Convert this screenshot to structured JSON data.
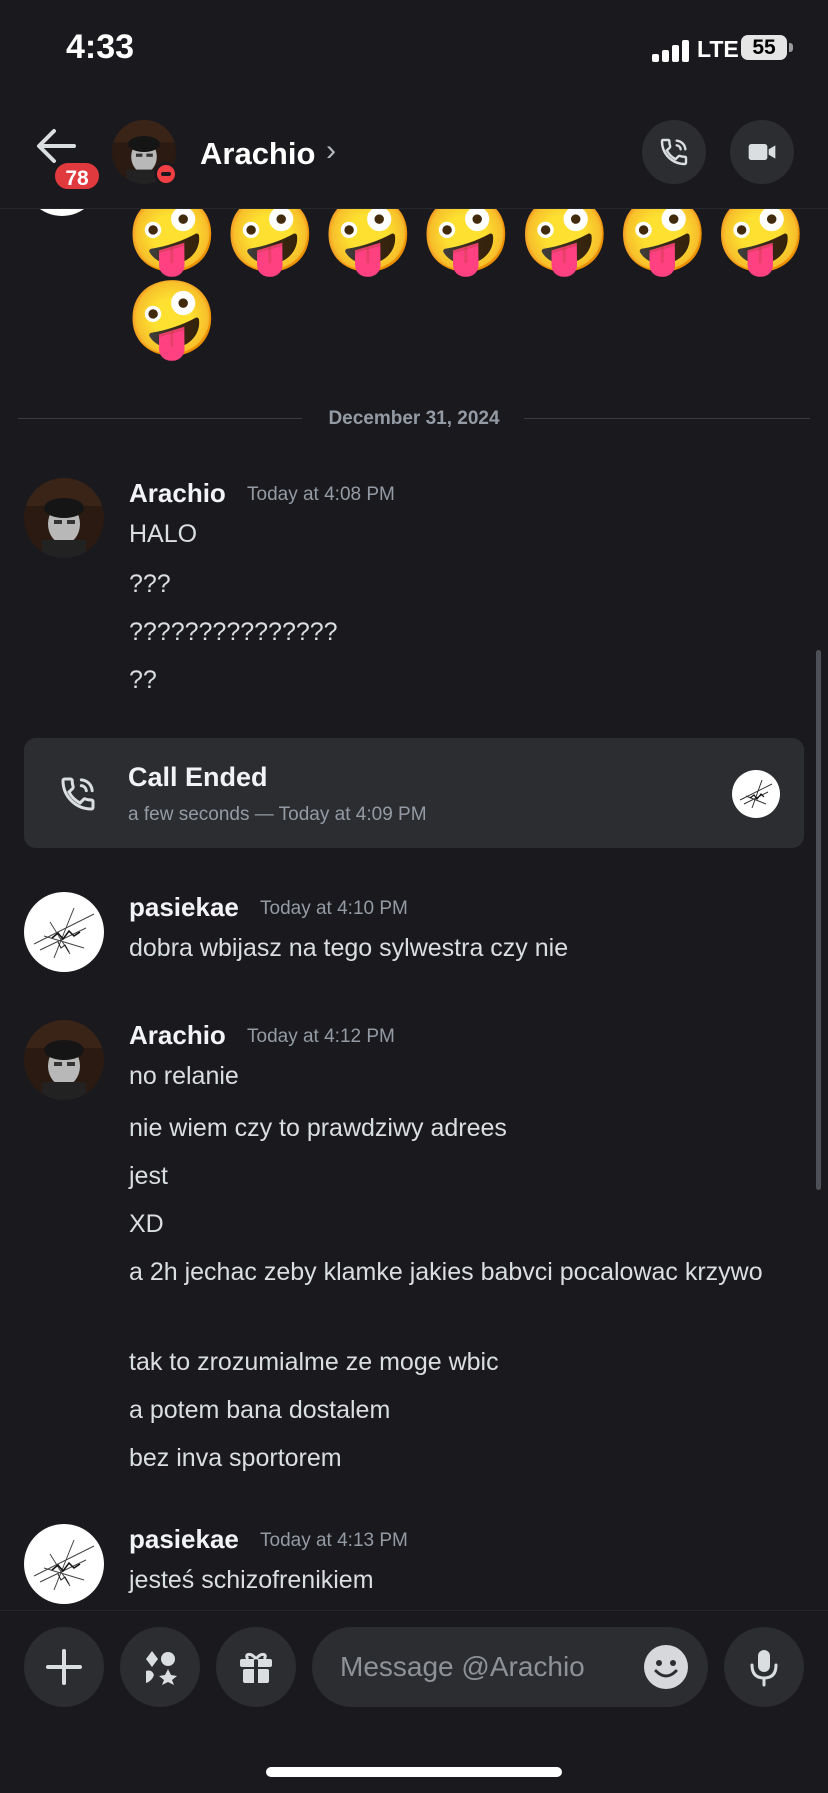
{
  "status_bar": {
    "time": "4:33",
    "network": "LTE",
    "battery": "55"
  },
  "header": {
    "unread_count": "78",
    "contact_name": "Arachio",
    "chevron": "›"
  },
  "chat": {
    "emoji_row_1": "🤪🤪🤪🤪🤪🤪🤪",
    "emoji_row_2": "🤪",
    "date_divider": "December 31, 2024",
    "groups": [
      {
        "author": "Arachio",
        "timestamp": "Today at 4:08 PM",
        "messages": [
          "HALO",
          "???",
          "???????????????",
          "??"
        ]
      },
      {
        "author": "pasiekae",
        "timestamp": "Today at 4:10 PM",
        "messages": [
          "dobra wbijasz na tego sylwestra czy nie"
        ]
      },
      {
        "author": "Arachio",
        "timestamp": "Today at 4:12 PM",
        "messages": [
          "no relanie",
          "nie wiem czy to prawdziwy adrees",
          "jest",
          "XD",
          "a 2h jechac zeby klamke jakies babvci pocalowac krzywo",
          "tak to zrozumialme ze moge wbic",
          "a potem bana dostalem",
          "bez inva sportorem"
        ]
      },
      {
        "author": "pasiekae",
        "timestamp": "Today at 4:13 PM",
        "messages": [
          "jesteś schizofrenikiem"
        ]
      }
    ],
    "call": {
      "title": "Call Ended",
      "subtitle": "a few seconds — Today at 4:09 PM"
    }
  },
  "composer": {
    "placeholder": "Message @Arachio"
  },
  "icons": [
    "back-arrow-icon",
    "phone-icon",
    "video-icon",
    "plus-icon",
    "apps-icon",
    "gift-icon",
    "emoji-icon",
    "microphone-icon"
  ]
}
